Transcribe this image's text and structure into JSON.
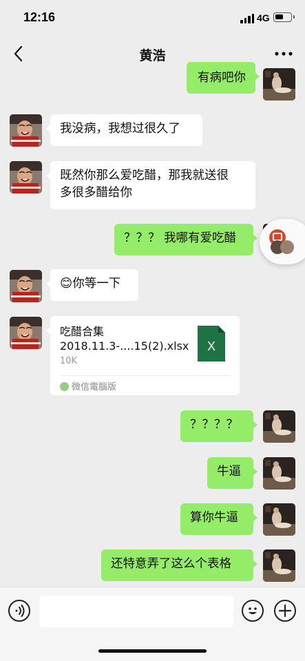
{
  "status_bar": {
    "time": "12:16",
    "network": "4G"
  },
  "nav": {
    "title": "黄浩"
  },
  "messages": [
    {
      "side": "right",
      "text": "有病吧你"
    },
    {
      "side": "left",
      "text": "我没病，我想过很久了"
    },
    {
      "side": "left",
      "line1": "既然你那么爱吃醋，那我就送很",
      "line2": "多很多醋给你"
    },
    {
      "side": "right",
      "text": "？？？ 我哪有爱吃醋"
    },
    {
      "side": "left",
      "emoji": "😊",
      "text": "你等一下"
    },
    {
      "side": "left",
      "type": "file",
      "file_name_line1": "吃醋合集",
      "file_name_line2": "2018.11.3-....15(2).xlsx",
      "file_size": "10K",
      "source": "微信電腦版",
      "file_icon_letter": "X"
    },
    {
      "side": "right",
      "text": "？？？？"
    },
    {
      "side": "right",
      "text": "牛逼"
    },
    {
      "side": "right",
      "text": "算你牛逼"
    },
    {
      "side": "right",
      "text": "还特意弄了这么个表格"
    }
  ],
  "input_bar": {
    "placeholder": ""
  },
  "colors": {
    "background": "#ededed",
    "bubble_self": "#95ec69",
    "bubble_other": "#ffffff",
    "excel_green": "#1f7244"
  },
  "icons": {
    "back": "chevron-left-icon",
    "more": "more-dots-icon",
    "voice": "voice-icon",
    "emoji": "emoji-icon",
    "plus": "plus-icon"
  }
}
